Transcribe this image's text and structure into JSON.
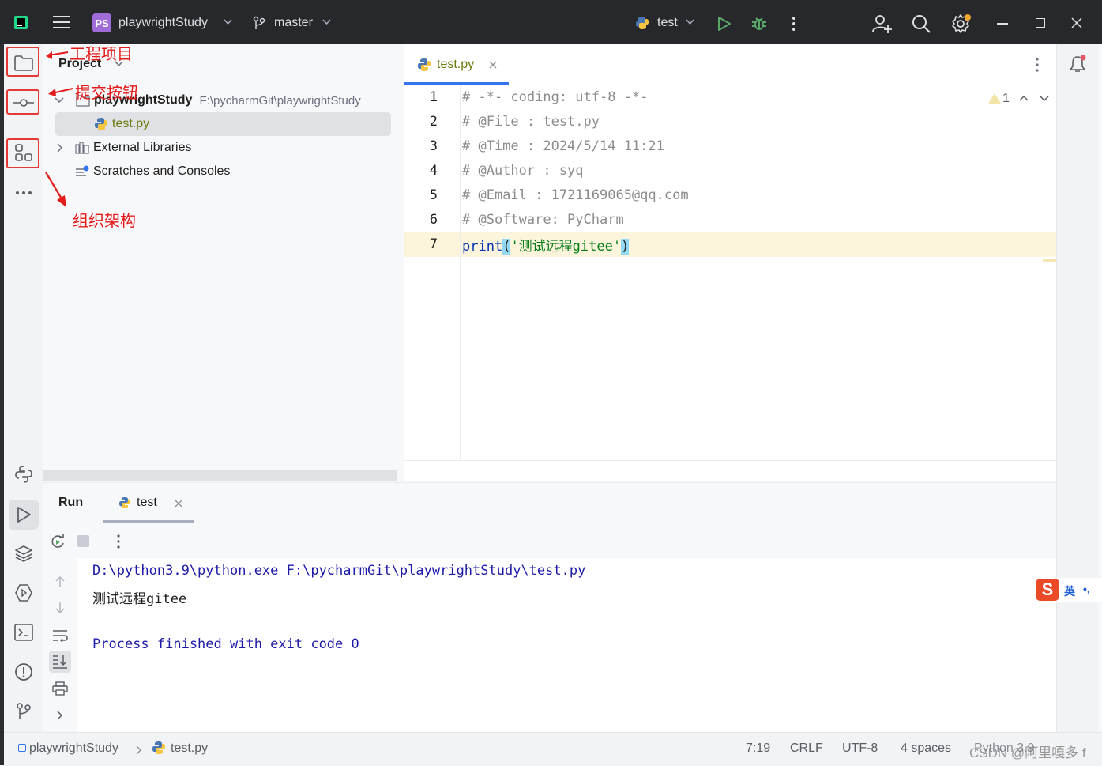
{
  "titlebar": {
    "project_badge": "PS",
    "project_name": "playwrightStudy",
    "branch": "master",
    "run_config": "test"
  },
  "project_panel": {
    "title": "Project",
    "root_name": "playwrightStudy",
    "root_path": "F:\\pycharmGit\\playwrightStudy",
    "file": "test.py",
    "external_libraries": "External Libraries",
    "scratches": "Scratches and Consoles"
  },
  "editor": {
    "tab": "test.py",
    "inspection_count": "1",
    "line_numbers": [
      "1",
      "2",
      "3",
      "4",
      "5",
      "6",
      "7"
    ],
    "lines": [
      "# -*- coding: utf-8 -*-",
      "# @File : test.py",
      "# @Time : 2024/5/14 11:21",
      "# @Author : syq",
      "# @Email : 1721169065@qq.com",
      "# @Software: PyCharm"
    ],
    "line7": {
      "func": "print",
      "open_paren": "(",
      "string": "'测试远程gitee'",
      "close_paren": ")"
    }
  },
  "run_panel": {
    "title": "Run",
    "tab": "test",
    "command": "D:\\python3.9\\python.exe F:\\pycharmGit\\playwrightStudy\\test.py",
    "output": "测试远程gitee",
    "exit_message": "Process finished with exit code 0"
  },
  "statusbar": {
    "project": "playwrightStudy",
    "file": "test.py",
    "position": "7:19",
    "line_ending": "CRLF",
    "encoding": "UTF-8",
    "indent": "4 spaces",
    "interpreter": "Python 3.9",
    "watermark": "CSDN @阿里嘎多 f"
  },
  "annotations": {
    "project": "工程项目",
    "commit": "提交按钮",
    "structure": "组织架构"
  },
  "ime": {
    "lang": "英",
    "punct": "•,"
  },
  "colors": {
    "accent": "#3574f0",
    "current_line": "#fcf5dc",
    "run_green": "#59a869",
    "annotation_red": "#e31b1b",
    "console_blue": "#1d1aa8"
  }
}
